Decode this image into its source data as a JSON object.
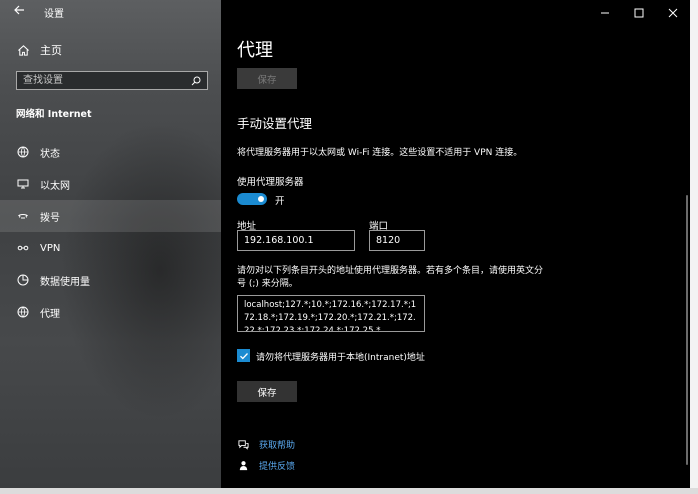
{
  "window": {
    "title": "设置",
    "controls": {
      "minimize": "minimize-icon",
      "maximize": "maximize-icon",
      "close": "close-icon"
    }
  },
  "sidebar": {
    "back_icon": "back-arrow-icon",
    "home_label": "主页",
    "search": {
      "placeholder": "查找设置",
      "value": ""
    },
    "section_heading": "网络和 Internet",
    "items": [
      {
        "label": "状态",
        "icon": "globe-status-icon"
      },
      {
        "label": "以太网",
        "icon": "monitor-icon"
      },
      {
        "label": "拨号",
        "icon": "phone-icon",
        "hovered": true
      },
      {
        "label": "VPN",
        "icon": "vpn-icon"
      },
      {
        "label": "数据使用量",
        "icon": "pie-chart-icon"
      },
      {
        "label": "代理",
        "icon": "globe-icon",
        "selected": true
      }
    ]
  },
  "content": {
    "page_title": "代理",
    "save_top_label": "保存",
    "subheading": "手动设置代理",
    "description": "将代理服务器用于以太网或 Wi-Fi 连接。这些设置不适用于 VPN 连接。",
    "use_proxy_label": "使用代理服务器",
    "toggle_state": "开",
    "toggle_on": true,
    "address_label": "地址",
    "address_value": "192.168.100.1",
    "port_label": "端口",
    "port_value": "8120",
    "exceptions_description": "请勿对以下列条目开头的地址使用代理服务器。若有多个条目，请使用英文分号 (;) 来分隔。",
    "exceptions_value": "localhost;127.*;10.*;172.16.*;172.17.*;172.18.*;172.19.*;172.20.*;172.21.*;172.22.*;172.23.*;172.24.*;172.25.*",
    "bypass_local_label": "请勿将代理服务器用于本地(Intranet)地址",
    "bypass_local_checked": true,
    "save_label": "保存",
    "help_link": "获取帮助",
    "feedback_link": "提供反馈"
  },
  "colors": {
    "accent": "#1b8bd1",
    "link": "#5aa9ef",
    "content_bg": "#000000",
    "sidebar_bg": "#4a4c4e"
  }
}
